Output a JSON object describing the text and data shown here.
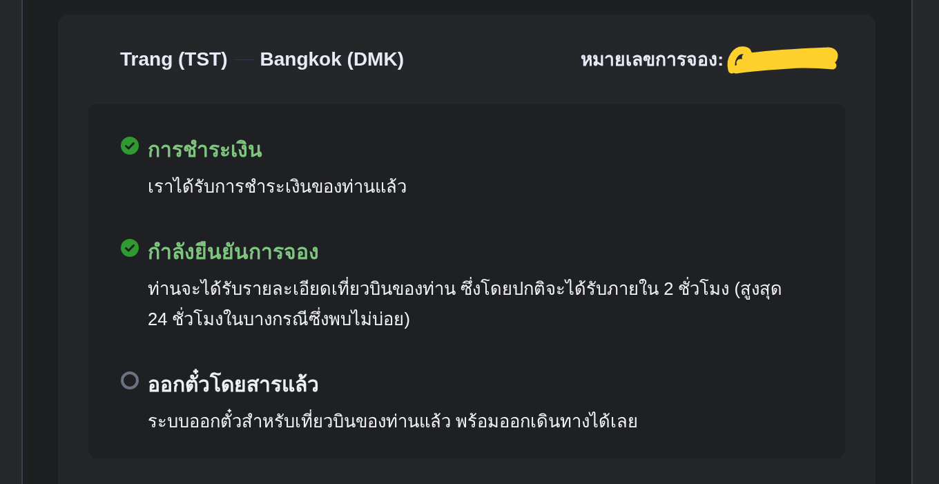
{
  "route": {
    "origin": "Trang (TST)",
    "destination": "Bangkok (DMK)"
  },
  "booking": {
    "label": "หมายเลขการจอง:",
    "number_redacted": true
  },
  "steps": [
    {
      "title": "การชำระเงิน",
      "description": "เราได้รับการชำระเงินของท่านแล้ว",
      "completed": true
    },
    {
      "title": "กำลังยืนยันการจอง",
      "description": "ท่านจะได้รับรายละเอียดเที่ยวบินของท่าน ซึ่งโดยปกติจะได้รับภายใน 2 ชั่วโมง (สูงสุด 24 ชั่วโมงในบางกรณีซึ่งพบไม่บ่อย)",
      "completed": true
    },
    {
      "title": "ออกตั๋วโดยสารแล้ว",
      "description": "ระบบออกตั๋วสำหรับเที่ยวบินของท่านแล้ว พร้อมออกเดินทางได้เลย",
      "completed": false
    }
  ]
}
